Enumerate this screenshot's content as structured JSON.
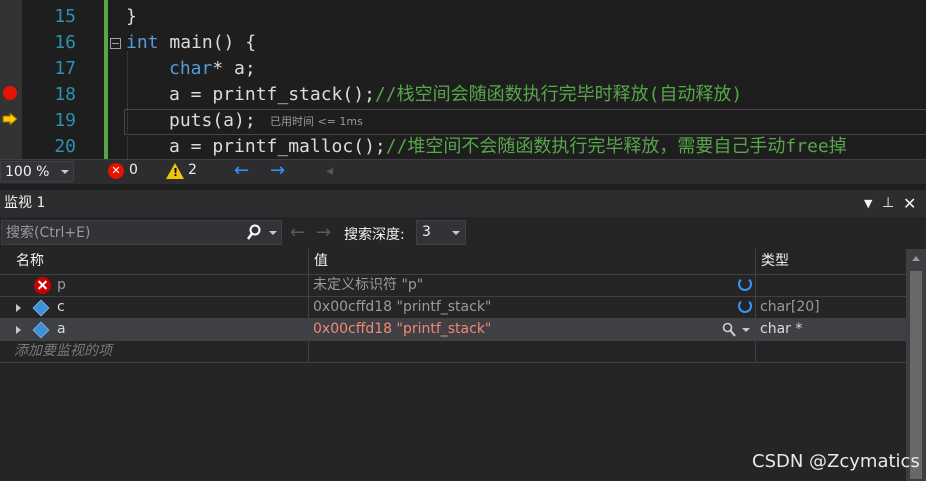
{
  "editor": {
    "lines": [
      {
        "num": "15",
        "code": "}"
      },
      {
        "num": "16",
        "code_kw": "int",
        "code_rest": " main() {"
      },
      {
        "num": "17",
        "code_kw": "char",
        "code_rest": "* a;"
      },
      {
        "num": "18",
        "code": "a = printf_stack();",
        "comment": "//栈空间会随函数执行完毕时释放(自动释放)"
      },
      {
        "num": "19",
        "code": "puts(a);"
      },
      {
        "num": "20",
        "code": "a = printf_malloc();",
        "comment": "//堆空间不会随函数执行完毕释放，需要自己手动free掉"
      }
    ],
    "elapsed_hint": "已用时间 <= 1ms"
  },
  "editor_status": {
    "zoom": "100 %",
    "errors": "0",
    "warnings": "2"
  },
  "watch": {
    "title": "监视 1",
    "search_placeholder": "搜索(Ctrl+E)",
    "depth_label": "搜索深度:",
    "depth_value": "3",
    "columns": {
      "name": "名称",
      "value": "值",
      "type": "类型"
    },
    "rows": [
      {
        "name": "p",
        "value": "未定义标识符 \"p\"",
        "type": ""
      },
      {
        "name": "c",
        "value": "0x00cffd18 \"printf_stack\"",
        "type": "char[20]"
      },
      {
        "name": "a",
        "value": "0x00cffd18 \"printf_stack\"",
        "type": "char *"
      }
    ],
    "add_placeholder": "添加要监视的项"
  },
  "colors": {
    "keyword": "#569cd6",
    "comment": "#57a64a",
    "line_number": "#2b91af",
    "changed_value": "#f48771",
    "error": "#e51400"
  },
  "watermark": "CSDN @Zcymatics"
}
